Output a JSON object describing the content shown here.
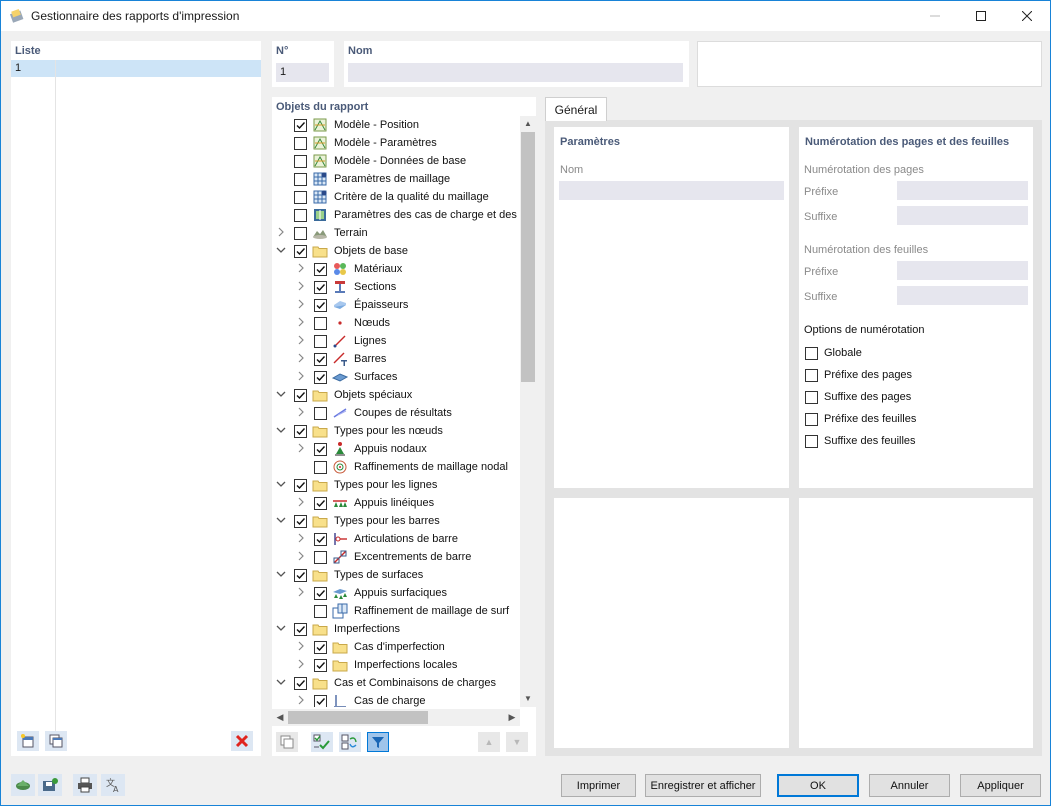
{
  "window": {
    "title": "Gestionnaire des rapports d'impression"
  },
  "list": {
    "header": "Liste",
    "selected_item": "1"
  },
  "number": {
    "header": "N°",
    "value": "1"
  },
  "name": {
    "header": "Nom",
    "value": ""
  },
  "tree": {
    "header": "Objets du rapport",
    "items": [
      {
        "label": "Modèle - Position",
        "checked": true,
        "level": 0,
        "chevron": "",
        "icon": "model-icon"
      },
      {
        "label": "Modèle - Paramètres",
        "checked": false,
        "level": 0,
        "chevron": "",
        "icon": "model-icon"
      },
      {
        "label": "Modèle - Données de base",
        "checked": false,
        "level": 0,
        "chevron": "",
        "icon": "model-icon"
      },
      {
        "label": "Paramètres de maillage",
        "checked": false,
        "level": 0,
        "chevron": "",
        "icon": "mesh-icon"
      },
      {
        "label": "Critère de la qualité du maillage",
        "checked": false,
        "level": 0,
        "chevron": "",
        "icon": "mesh-icon"
      },
      {
        "label": "Paramètres des cas de charge et des",
        "checked": false,
        "level": 0,
        "chevron": "",
        "icon": "loadcase-settings-icon"
      },
      {
        "label": "Terrain",
        "checked": false,
        "level": 0,
        "chevron": "right",
        "icon": "terrain-icon"
      },
      {
        "label": "Objets de base",
        "checked": true,
        "level": 0,
        "chevron": "down",
        "icon": "folder-icon"
      },
      {
        "label": "Matériaux",
        "checked": true,
        "level": 1,
        "chevron": "right",
        "icon": "materials-icon"
      },
      {
        "label": "Sections",
        "checked": true,
        "level": 1,
        "chevron": "right",
        "icon": "section-icon"
      },
      {
        "label": "Épaisseurs",
        "checked": true,
        "level": 1,
        "chevron": "right",
        "icon": "thickness-icon"
      },
      {
        "label": "Nœuds",
        "checked": false,
        "level": 1,
        "chevron": "right",
        "icon": "node-icon"
      },
      {
        "label": "Lignes",
        "checked": false,
        "level": 1,
        "chevron": "right",
        "icon": "line-icon"
      },
      {
        "label": "Barres",
        "checked": true,
        "level": 1,
        "chevron": "right",
        "icon": "member-icon"
      },
      {
        "label": "Surfaces",
        "checked": true,
        "level": 1,
        "chevron": "right",
        "icon": "surface-icon"
      },
      {
        "label": "Objets spéciaux",
        "checked": true,
        "level": 0,
        "chevron": "down",
        "icon": "folder-icon"
      },
      {
        "label": "Coupes de résultats",
        "checked": false,
        "level": 1,
        "chevron": "right",
        "icon": "result-section-icon"
      },
      {
        "label": "Types pour les nœuds",
        "checked": true,
        "level": 0,
        "chevron": "down",
        "icon": "folder-icon"
      },
      {
        "label": "Appuis nodaux",
        "checked": true,
        "level": 1,
        "chevron": "right",
        "icon": "nodal-support-icon"
      },
      {
        "label": "Raffinements de maillage nodal",
        "checked": false,
        "level": 1,
        "chevron": "",
        "icon": "mesh-refinement-icon"
      },
      {
        "label": "Types pour les lignes",
        "checked": true,
        "level": 0,
        "chevron": "down",
        "icon": "folder-icon"
      },
      {
        "label": "Appuis linéiques",
        "checked": true,
        "level": 1,
        "chevron": "right",
        "icon": "line-support-icon"
      },
      {
        "label": "Types pour les barres",
        "checked": true,
        "level": 0,
        "chevron": "down",
        "icon": "folder-icon"
      },
      {
        "label": "Articulations de barre",
        "checked": true,
        "level": 1,
        "chevron": "right",
        "icon": "hinge-icon"
      },
      {
        "label": "Excentrements de barre",
        "checked": false,
        "level": 1,
        "chevron": "right",
        "icon": "eccentricity-icon"
      },
      {
        "label": "Types de surfaces",
        "checked": true,
        "level": 0,
        "chevron": "down",
        "icon": "folder-icon"
      },
      {
        "label": "Appuis surfaciques",
        "checked": true,
        "level": 1,
        "chevron": "right",
        "icon": "surface-support-icon"
      },
      {
        "label": "Raffinement de maillage de surf",
        "checked": false,
        "level": 1,
        "chevron": "",
        "icon": "surface-mesh-icon"
      },
      {
        "label": "Imperfections",
        "checked": true,
        "level": 0,
        "chevron": "down",
        "icon": "folder-icon"
      },
      {
        "label": "Cas d'imperfection",
        "checked": true,
        "level": 1,
        "chevron": "right",
        "icon": "folder-icon"
      },
      {
        "label": "Imperfections locales",
        "checked": true,
        "level": 1,
        "chevron": "right",
        "icon": "folder-icon"
      },
      {
        "label": "Cas et Combinaisons de charges",
        "checked": true,
        "level": 0,
        "chevron": "down",
        "icon": "folder-icon"
      },
      {
        "label": "Cas de charge",
        "checked": true,
        "level": 1,
        "chevron": "right",
        "icon": "load-case-icon"
      }
    ]
  },
  "tabs": {
    "general": "Général"
  },
  "params": {
    "header": "Paramètres",
    "name_label": "Nom",
    "name_value": ""
  },
  "numbering": {
    "header": "Numérotation des pages et des feuilles",
    "pages_label": "Numérotation des pages",
    "sheets_label": "Numérotation des feuilles",
    "prefix_label": "Préfixe",
    "suffix_label": "Suffixe",
    "options_label": "Options de numérotation",
    "options": [
      {
        "label": "Globale",
        "checked": false
      },
      {
        "label": "Préfixe des pages",
        "checked": false
      },
      {
        "label": "Suffixe des pages",
        "checked": false
      },
      {
        "label": "Préfixe des feuilles",
        "checked": false
      },
      {
        "label": "Suffixe des feuilles",
        "checked": false
      }
    ]
  },
  "buttons": {
    "print": "Imprimer",
    "save_show": "Enregistrer et afficher",
    "ok": "OK",
    "cancel": "Annuler",
    "apply": "Appliquer"
  },
  "colors": {
    "accent": "#0078d7",
    "header_text": "#4a5a78",
    "selection": "#cde4f7",
    "delete_red": "#e0241e"
  }
}
